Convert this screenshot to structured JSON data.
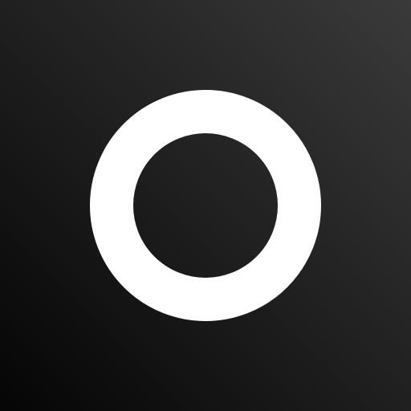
{
  "logo": {
    "icon": "ring-icon",
    "colors": {
      "background_top": "#3a3a3a",
      "background_bottom": "#050505",
      "ring": "#ffffff"
    }
  }
}
